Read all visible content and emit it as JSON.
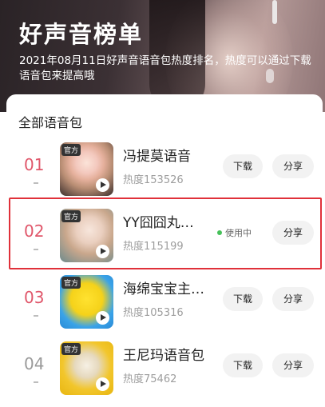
{
  "header": {
    "title": "好声音榜单",
    "description": "2021年08月11日好声音语音包热度排名，热度可以通过下载语音包来提高哦"
  },
  "section": {
    "title": "全部语音包"
  },
  "items": [
    {
      "rank": "01",
      "name": "冯提莫语音",
      "heat": "热度153526",
      "tag": "官方",
      "action": "下载",
      "share": "分享"
    },
    {
      "rank": "02",
      "name": "YY囧囧丸…",
      "heat": "热度115199",
      "tag": "官方",
      "status": "使用中",
      "share": "分享"
    },
    {
      "rank": "03",
      "name": "海绵宝宝主…",
      "heat": "热度105316",
      "tag": "官方",
      "action": "下载",
      "share": "分享"
    },
    {
      "rank": "04",
      "name": "王尼玛语音包",
      "heat": "热度75462",
      "tag": "官方",
      "action": "下载",
      "share": "分享"
    }
  ],
  "colors": {
    "rank_top": "#e0576b",
    "rank_other": "#9a9a9a",
    "highlight_border": "#e0313a",
    "status_dot": "#46c15a"
  }
}
